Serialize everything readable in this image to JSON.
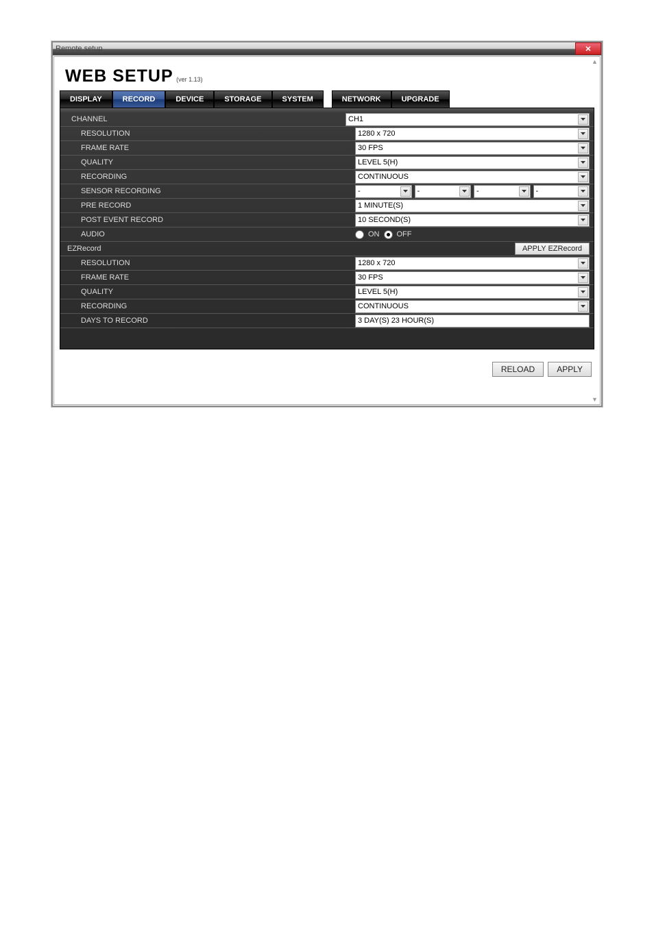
{
  "window": {
    "title": "Remote setup"
  },
  "header": {
    "title": "WEB SETUP",
    "version": "(ver 1.13)"
  },
  "tabs": {
    "display": "DISPLAY",
    "record": "RECORD",
    "device": "DEVICE",
    "storage": "STORAGE",
    "system": "SYSTEM",
    "network": "NETWORK",
    "upgrade": "UPGRADE"
  },
  "labels": {
    "channel": "CHANNEL",
    "resolution": "RESOLUTION",
    "framerate": "FRAME RATE",
    "quality": "QUALITY",
    "recording": "RECORDING",
    "sensor": "SENSOR RECORDING",
    "pre": "PRE RECORD",
    "post": "POST EVENT RECORD",
    "audio": "AUDIO",
    "ezrecord": "EZRecord",
    "days": "DAYS TO RECORD"
  },
  "values": {
    "channel": "CH1",
    "resolution": "1280 x 720",
    "framerate": "30 FPS",
    "quality": "LEVEL 5(H)",
    "recording": "CONTINUOUS",
    "sensor1": "-",
    "sensor2": "-",
    "sensor3": "-",
    "sensor4": "-",
    "pre": "1 MINUTE(S)",
    "post": "10 SECOND(S)",
    "audio_on": "ON",
    "audio_off": "OFF",
    "ez_resolution": "1280 x 720",
    "ez_framerate": "30 FPS",
    "ez_quality": "LEVEL 5(H)",
    "ez_recording": "CONTINUOUS",
    "days": "3 DAY(S) 23 HOUR(S)"
  },
  "buttons": {
    "apply_ez": "APPLY EZRecord",
    "reload": "RELOAD",
    "apply": "APPLY"
  }
}
